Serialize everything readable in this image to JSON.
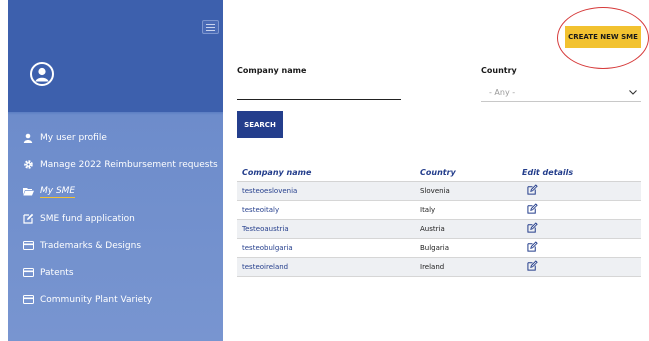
{
  "sidebar": {
    "items": [
      {
        "label": "My user profile",
        "icon": "user-icon"
      },
      {
        "label": "Manage 2022 Reimbursement requests",
        "icon": "gear-icon"
      },
      {
        "label": "My SME",
        "icon": "folder-open-icon",
        "active": true
      },
      {
        "label": "SME fund application",
        "icon": "edit-icon"
      },
      {
        "label": "Trademarks & Designs",
        "icon": "card-icon"
      },
      {
        "label": "Patents",
        "icon": "card-icon"
      },
      {
        "label": "Community Plant Variety",
        "icon": "card-icon"
      }
    ]
  },
  "header": {
    "create_label": "CREATE NEW SME"
  },
  "filters": {
    "company_label": "Company name",
    "company_value": "",
    "country_label": "Country",
    "country_selected": "- Any -",
    "search_label": "SEARCH"
  },
  "table": {
    "headers": [
      "Company name",
      "Country",
      "Edit details"
    ],
    "rows": [
      {
        "company": "testeoeslovenia",
        "country": "Slovenia"
      },
      {
        "company": "testeoitaly",
        "country": "Italy"
      },
      {
        "company": "Testeoaustria",
        "country": "Austria"
      },
      {
        "company": "testeobulgaria",
        "country": "Bulgaria"
      },
      {
        "company": "testeoireland",
        "country": "Ireland"
      }
    ]
  },
  "colors": {
    "sidebar_dark": "#3d60ad",
    "sidebar_light": "#7895d0",
    "accent_yellow": "#f2c230",
    "primary_blue": "#243e8c",
    "highlight_red": "#d63a3a"
  }
}
